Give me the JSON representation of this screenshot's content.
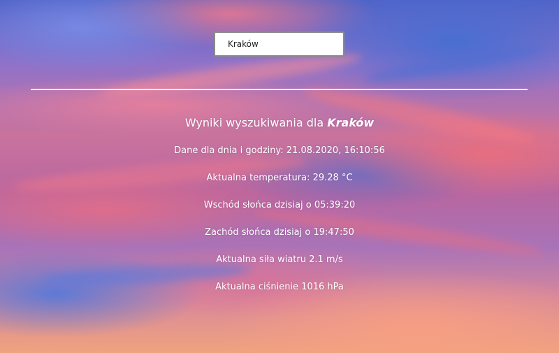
{
  "search": {
    "value": "Kraków",
    "placeholder": ""
  },
  "results": {
    "title_prefix": "Wyniki wyszukiwania dla",
    "city": "Kraków",
    "lines": [
      "Dane dla dnia i godziny: 21.08.2020, 16:10:56",
      "Aktualna temperatura: 29.28 °C",
      "Wschód słońca dzisiaj o 05:39:20",
      "Zachód słońca dzisiaj o 19:47:50",
      "Aktualna siła wiatru 2.1 m/s",
      "Aktualna ciśnienie 1016 hPa"
    ]
  },
  "colors": {
    "text": "#ffffff",
    "divider": "#f2f2f2",
    "input_border": "#8a8a8a"
  }
}
